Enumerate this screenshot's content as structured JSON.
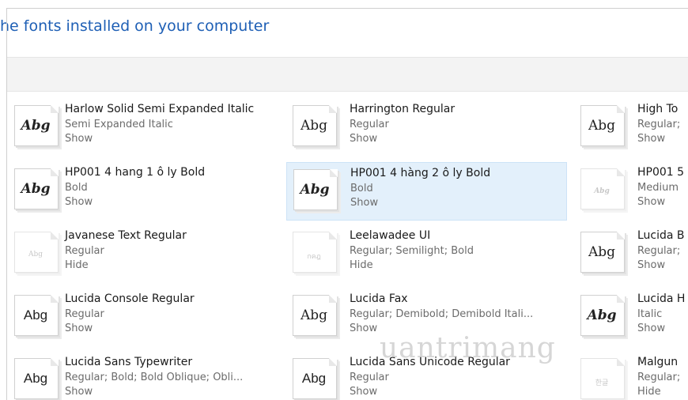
{
  "header": {
    "title": "he fonts installed on your computer"
  },
  "fonts": [
    {
      "name": "Harlow Solid Semi Expanded Italic",
      "styles": "Semi Expanded Italic",
      "action": "Show",
      "glyph": "Abg"
    },
    {
      "name": "Harrington Regular",
      "styles": "Regular",
      "action": "Show",
      "glyph": "Abg"
    },
    {
      "name": "High To",
      "styles": "Regular;",
      "action": "Show",
      "glyph": "Abg"
    },
    {
      "name": "HP001 4 hang 1 ô ly Bold",
      "styles": "Bold",
      "action": "Show",
      "glyph": "Abg"
    },
    {
      "name": "HP001 4 hàng 2 ô ly Bold",
      "styles": "Bold",
      "action": "Show",
      "glyph": "Abg"
    },
    {
      "name": "HP001 5",
      "styles": "Medium",
      "action": "Show",
      "glyph": "Abg"
    },
    {
      "name": "Javanese Text Regular",
      "styles": "Regular",
      "action": "Hide",
      "glyph": "Abg"
    },
    {
      "name": "Leelawadee UI",
      "styles": "Regular; Semilight; Bold",
      "action": "Hide",
      "glyph": "กคฎ"
    },
    {
      "name": "Lucida B",
      "styles": "Regular;",
      "action": "Show",
      "glyph": "Abg"
    },
    {
      "name": "Lucida Console Regular",
      "styles": "Regular",
      "action": "Show",
      "glyph": "Abg"
    },
    {
      "name": "Lucida Fax",
      "styles": "Regular; Demibold; Demibold Itali...",
      "action": "Show",
      "glyph": "Abg"
    },
    {
      "name": "Lucida H",
      "styles": "Italic",
      "action": "Show",
      "glyph": "Abg"
    },
    {
      "name": "Lucida Sans Typewriter",
      "styles": "Regular; Bold; Bold Oblique; Obli...",
      "action": "Show",
      "glyph": "Abg"
    },
    {
      "name": "Lucida Sans Unicode Regular",
      "styles": "Regular",
      "action": "Show",
      "glyph": "Abg"
    },
    {
      "name": "Malgun",
      "styles": "Regular;",
      "action": "Hide",
      "glyph": "한글"
    }
  ],
  "watermark": {
    "text": "uantrimang"
  }
}
